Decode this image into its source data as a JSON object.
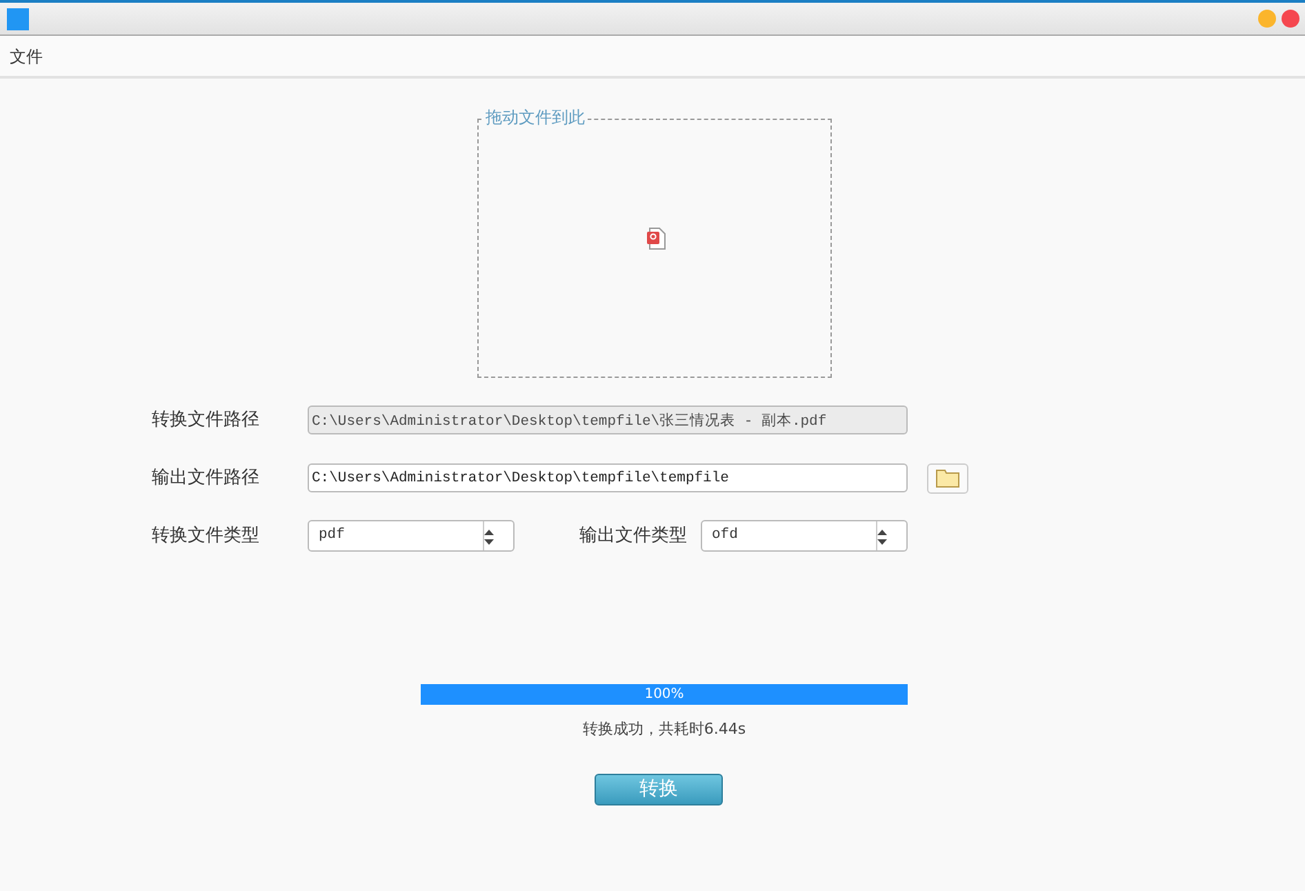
{
  "menu": [
    {
      "label": "文件"
    }
  ],
  "drop_zone": {
    "legend": "拖动文件到此"
  },
  "source_path": {
    "label": "转换文件路径",
    "value": "C:\\Users\\Administrator\\Desktop\\tempfile\\张三情况表 - 副本.pdf",
    "disabled": true
  },
  "output_path": {
    "label": "输出文件路径",
    "value": "C:\\Users\\Administrator\\Desktop\\tempfile\\tempfile",
    "disabled": false
  },
  "source_type": {
    "label": "转换文件类型",
    "value": "pdf"
  },
  "output_type": {
    "label": "输出文件类型",
    "value": "ofd"
  },
  "progress": {
    "level": 1,
    "label": "100%"
  },
  "status": "转换成功，共耗时6.44s",
  "convert_button": "转换"
}
